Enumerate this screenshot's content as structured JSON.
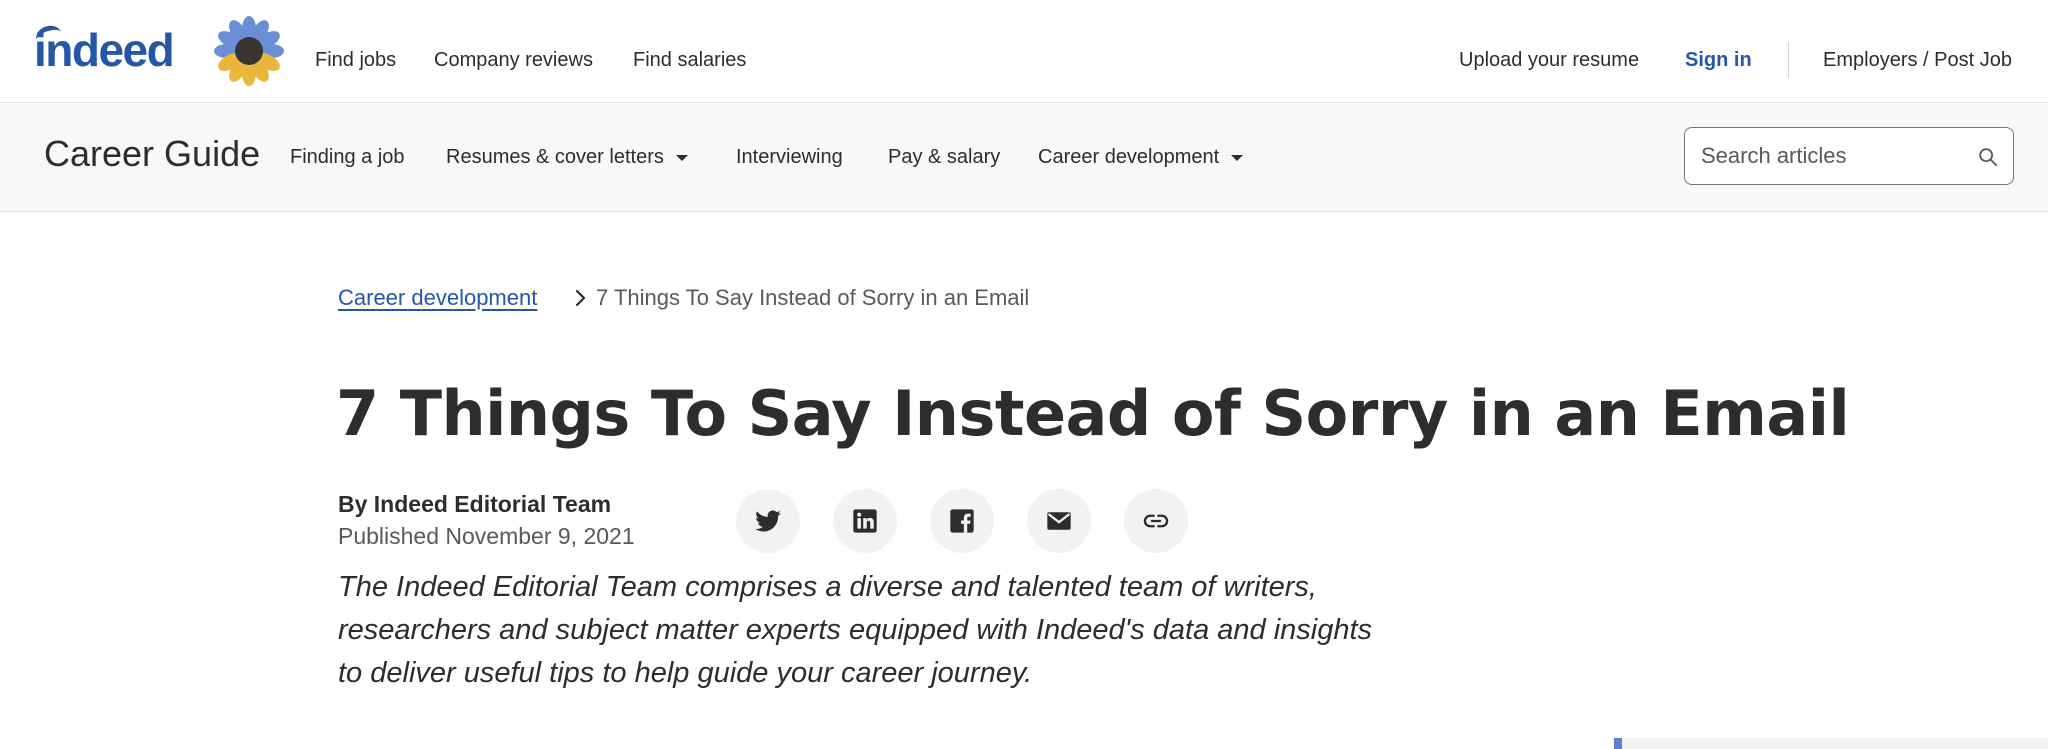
{
  "header": {
    "logo_text": "indeed",
    "nav": [
      "Find jobs",
      "Company reviews",
      "Find salaries"
    ],
    "upload_resume": "Upload your resume",
    "sign_in": "Sign in",
    "employers": "Employers / Post Job"
  },
  "subnav": {
    "brand": "Career Guide",
    "items": [
      {
        "label": "Finding a job"
      },
      {
        "label": "Resumes & cover letters"
      },
      {
        "label": "Interviewing"
      },
      {
        "label": "Pay & salary"
      },
      {
        "label": "Career development"
      }
    ],
    "search_placeholder": "Search articles"
  },
  "breadcrumb": {
    "parent": "Career development",
    "current": "7 Things To Say Instead of Sorry in an Email"
  },
  "article": {
    "title": "7 Things To Say Instead of Sorry in an Email",
    "author": "By Indeed Editorial Team",
    "published": "Published November 9, 2021",
    "bio": "The Indeed Editorial Team comprises a diverse and talented team of writers, researchers and subject matter experts equipped with Indeed's data and insights to deliver useful tips to help guide your career journey.",
    "share_icons": [
      "twitter-icon",
      "linkedin-icon",
      "facebook-icon",
      "email-icon",
      "link-icon"
    ]
  },
  "colors": {
    "brand_blue": "#2557a7",
    "text": "#2d2d2d",
    "muted": "#595959",
    "subnav_bg": "#f8f8f8"
  }
}
